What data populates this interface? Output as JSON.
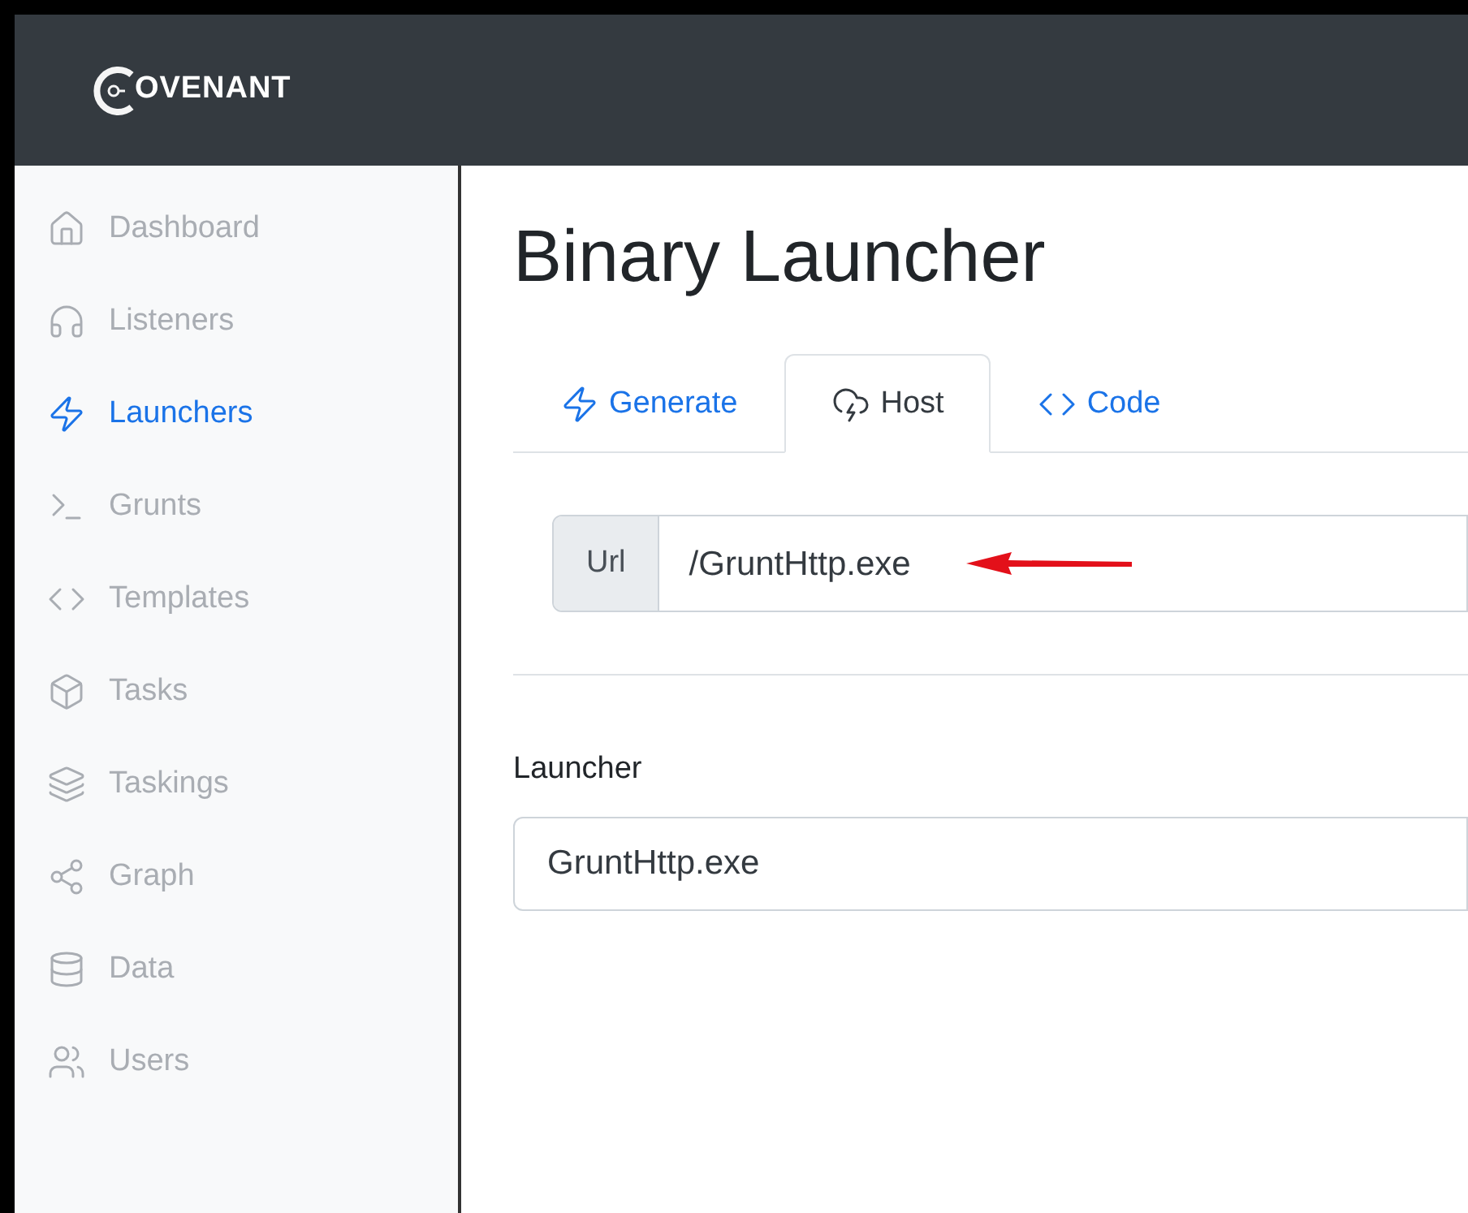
{
  "logo": {
    "text": "OVENANT"
  },
  "sidebar": {
    "items": [
      {
        "label": "Dashboard",
        "selected": false
      },
      {
        "label": "Listeners",
        "selected": false
      },
      {
        "label": "Launchers",
        "selected": true
      },
      {
        "label": "Grunts",
        "selected": false
      },
      {
        "label": "Templates",
        "selected": false
      },
      {
        "label": "Tasks",
        "selected": false
      },
      {
        "label": "Taskings",
        "selected": false
      },
      {
        "label": "Graph",
        "selected": false
      },
      {
        "label": "Data",
        "selected": false
      },
      {
        "label": "Users",
        "selected": false
      }
    ]
  },
  "page": {
    "title": "Binary Launcher"
  },
  "tabs": [
    {
      "label": "Generate",
      "selected": false
    },
    {
      "label": "Host",
      "selected": true
    },
    {
      "label": "Code",
      "selected": false
    }
  ],
  "url_field": {
    "label": "Url",
    "value": "/GruntHttp.exe"
  },
  "launcher_field": {
    "label": "Launcher",
    "value": "GruntHttp.exe"
  }
}
